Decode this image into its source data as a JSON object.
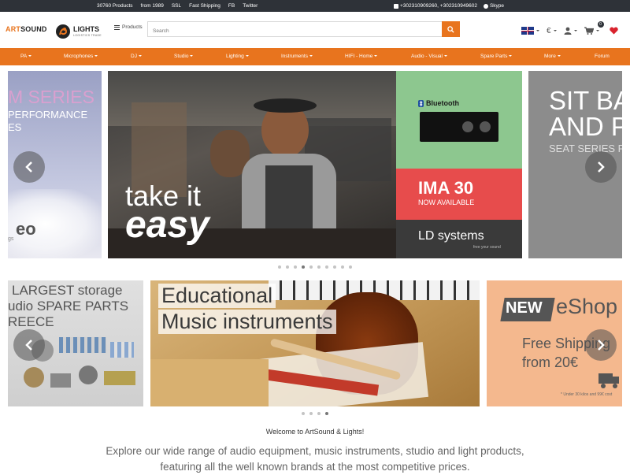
{
  "topbar": {
    "left_items": [
      "30760 Products",
      "from 1989",
      "SSL",
      "Fast Shipping",
      "FB",
      "Twitter"
    ],
    "phone": "+302310909260, +302310949602",
    "skype": "Skype"
  },
  "header": {
    "logo": {
      "part1": "ART",
      "part2": "SOUND",
      "part3": "LIGHTS",
      "tagline": "LOGISTICS TRADE"
    },
    "products_label": "Products",
    "search": {
      "placeholder": "Search",
      "value": ""
    },
    "language_icon": "uk-flag-icon",
    "currency": "€",
    "cart_count": "0"
  },
  "nav": {
    "items": [
      {
        "label": "PA",
        "has_menu": true
      },
      {
        "label": "Microphones",
        "has_menu": true
      },
      {
        "label": "DJ",
        "has_menu": true
      },
      {
        "label": "Studio",
        "has_menu": true
      },
      {
        "label": "Lighting",
        "has_menu": true
      },
      {
        "label": "Instruments",
        "has_menu": true
      },
      {
        "label": "HIFI - Home",
        "has_menu": true
      },
      {
        "label": "Audio - Visual",
        "has_menu": true
      },
      {
        "label": "Spare Parts",
        "has_menu": true
      },
      {
        "label": "More",
        "has_menu": true
      },
      {
        "label": "Forum",
        "has_menu": false
      }
    ]
  },
  "slider1": {
    "left_banner": {
      "line1": "M SERIES",
      "line2": "PERFORMANCE",
      "line3": "ES",
      "brand": "eo",
      "brand_sub": "gs"
    },
    "main_banner": {
      "line1": "take it",
      "line2": "easy",
      "bt_label": "Bluetooth",
      "ima_title": "IMA 30",
      "ima_sub": "NOW AVAILABLE",
      "ld_brand": "LD systems",
      "ld_tagline": "free your sound"
    },
    "right_banner": {
      "line1": "SIT BA",
      "line2": "AND P",
      "line3": "SEAT SERIES FD"
    },
    "dot_count": 10,
    "active_dot": 3
  },
  "slider2": {
    "left_banner": {
      "line1": "LARGEST storage",
      "line2": "udio SPARE PARTS",
      "line3": "REECE"
    },
    "main_banner": {
      "line1": "Educational",
      "line2": "Music instruments"
    },
    "right_banner": {
      "line1": "NEW",
      "line2": "eShop",
      "line3": "Free Shipping",
      "line4": "from 20€",
      "note": "* Under 30 kilos and 99€ cost"
    },
    "dot_count": 4,
    "active_dot": 3
  },
  "welcome": "Welcome to ArtSound & Lights!",
  "intro_line1": "Explore our wide range of audio equipment, music instruments, studio and light products,",
  "intro_line2": "featuring all the well known brands at the most competitive prices.",
  "colors": {
    "accent": "#e8741e",
    "topbar": "#2e3238",
    "heart": "#d9232d"
  }
}
